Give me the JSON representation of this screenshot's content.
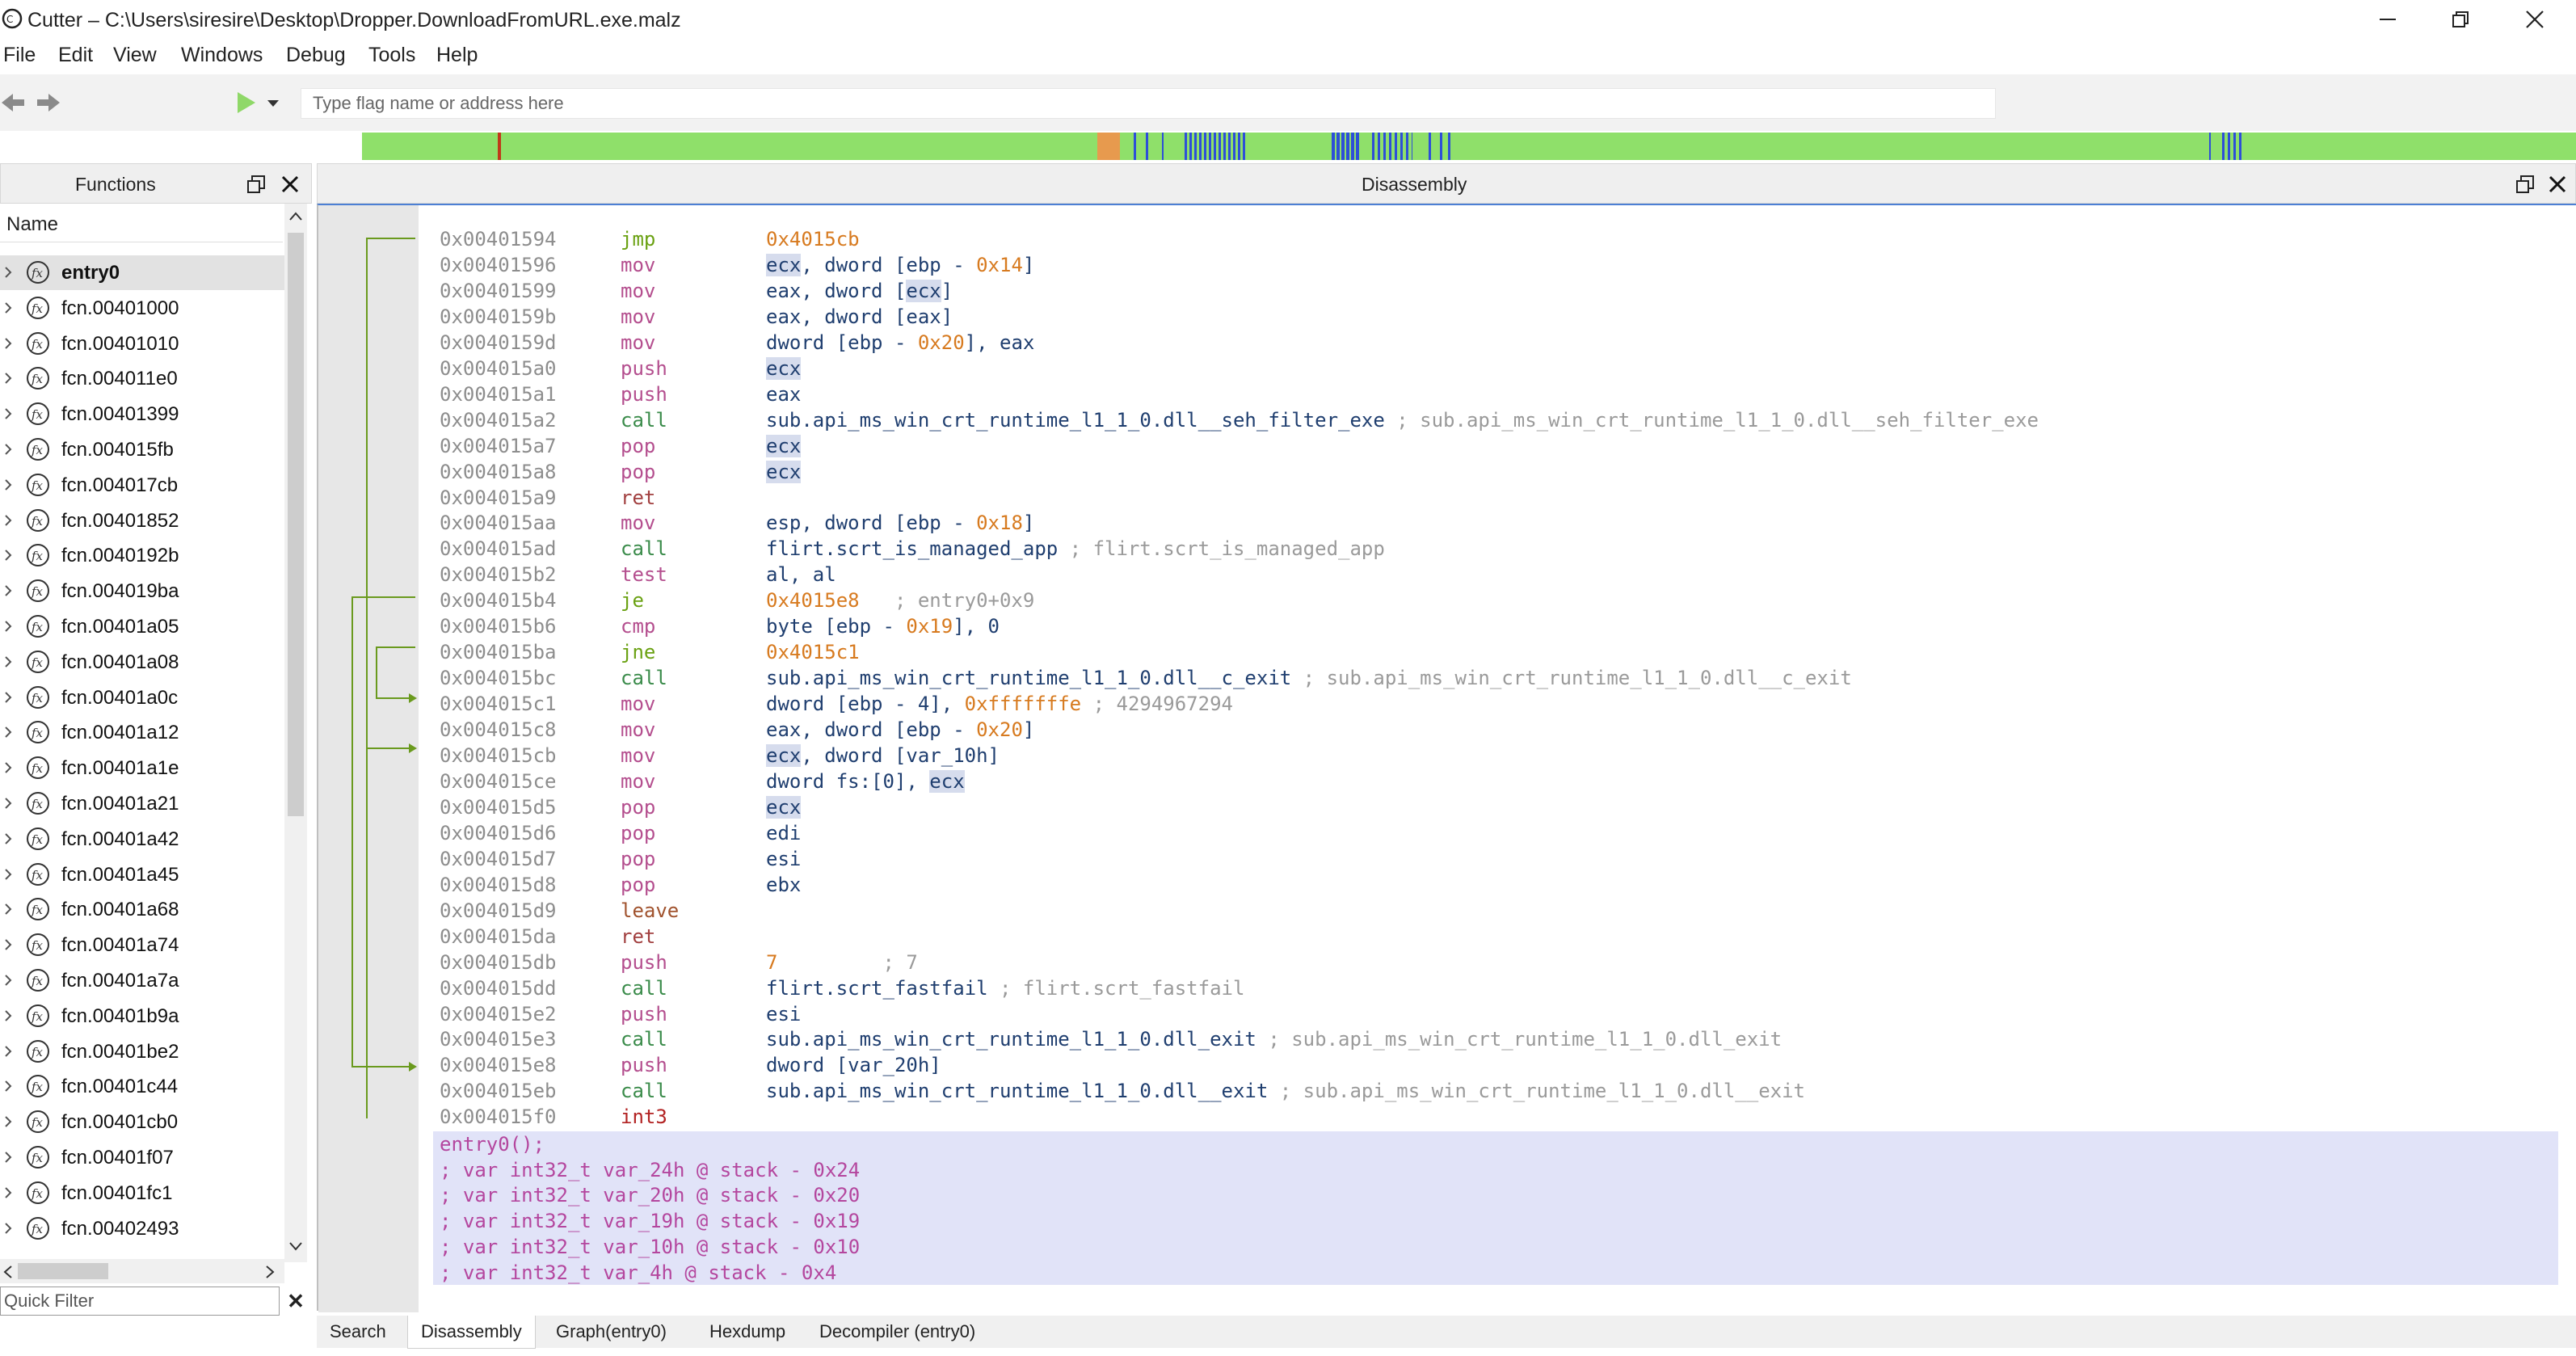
{
  "window": {
    "title": "Cutter – C:\\Users\\siresire\\Desktop\\Dropper.DownloadFromURL.exe.malz",
    "minimize_icon": "minimize-icon",
    "restore_icon": "restore-icon",
    "close_icon": "close-icon"
  },
  "menu": [
    "File",
    "Edit",
    "View",
    "Windows",
    "Debug",
    "Tools",
    "Help"
  ],
  "toolbar": {
    "search_placeholder": "Type flag name or address here"
  },
  "functions_panel": {
    "title": "Functions",
    "column": "Name",
    "filter_placeholder": "Quick Filter",
    "items": [
      "entry0",
      "fcn.00401000",
      "fcn.00401010",
      "fcn.004011e0",
      "fcn.00401399",
      "fcn.004015fb",
      "fcn.004017cb",
      "fcn.00401852",
      "fcn.0040192b",
      "fcn.004019ba",
      "fcn.00401a05",
      "fcn.00401a08",
      "fcn.00401a0c",
      "fcn.00401a12",
      "fcn.00401a1e",
      "fcn.00401a21",
      "fcn.00401a42",
      "fcn.00401a45",
      "fcn.00401a68",
      "fcn.00401a74",
      "fcn.00401a7a",
      "fcn.00401b9a",
      "fcn.00401be2",
      "fcn.00401c44",
      "fcn.00401cb0",
      "fcn.00401f07",
      "fcn.00401fc1",
      "fcn.00402493"
    ]
  },
  "disassembly": {
    "title": "Disassembly",
    "rows": [
      {
        "addr": "0x00401594",
        "mn": "jmp",
        "op": [
          {
            "t": "0x4015cb",
            "c": "o-addr"
          }
        ]
      },
      {
        "addr": "0x00401596",
        "mn": "mov",
        "op": [
          {
            "t": "ecx",
            "c": "o-def reg-hl"
          },
          {
            "t": ", dword [ebp - ",
            "c": "o-def"
          },
          {
            "t": "0x14",
            "c": "o-imm"
          },
          {
            "t": "]",
            "c": "o-def"
          }
        ]
      },
      {
        "addr": "0x00401599",
        "mn": "mov",
        "op": [
          {
            "t": "eax, dword [",
            "c": "o-def"
          },
          {
            "t": "ecx",
            "c": "o-def reg-hl"
          },
          {
            "t": "]",
            "c": "o-def"
          }
        ]
      },
      {
        "addr": "0x0040159b",
        "mn": "mov",
        "op": [
          {
            "t": "eax, dword [eax]",
            "c": "o-def"
          }
        ]
      },
      {
        "addr": "0x0040159d",
        "mn": "mov",
        "op": [
          {
            "t": "dword [ebp - ",
            "c": "o-def"
          },
          {
            "t": "0x20",
            "c": "o-imm"
          },
          {
            "t": "], eax",
            "c": "o-def"
          }
        ]
      },
      {
        "addr": "0x004015a0",
        "mn": "push",
        "op": [
          {
            "t": "ecx",
            "c": "o-def reg-hl"
          }
        ]
      },
      {
        "addr": "0x004015a1",
        "mn": "push",
        "op": [
          {
            "t": "eax",
            "c": "o-def"
          }
        ]
      },
      {
        "addr": "0x004015a2",
        "mn": "call",
        "op": [
          {
            "t": "sub.api_ms_win_crt_runtime_l1_1_0.dll__seh_filter_exe",
            "c": "o-def"
          },
          {
            "t": " ; sub.api_ms_win_crt_runtime_l1_1_0.dll__seh_filter_exe",
            "c": "o-cmt"
          }
        ]
      },
      {
        "addr": "0x004015a7",
        "mn": "pop",
        "op": [
          {
            "t": "ecx",
            "c": "o-def reg-hl"
          }
        ]
      },
      {
        "addr": "0x004015a8",
        "mn": "pop",
        "op": [
          {
            "t": "ecx",
            "c": "o-def reg-hl"
          }
        ]
      },
      {
        "addr": "0x004015a9",
        "mn": "ret",
        "op": []
      },
      {
        "addr": "0x004015aa",
        "mn": "mov",
        "op": [
          {
            "t": "esp, dword [ebp - ",
            "c": "o-def"
          },
          {
            "t": "0x18",
            "c": "o-imm"
          },
          {
            "t": "]",
            "c": "o-def"
          }
        ]
      },
      {
        "addr": "0x004015ad",
        "mn": "call",
        "op": [
          {
            "t": "flirt.scrt_is_managed_app",
            "c": "o-def"
          },
          {
            "t": " ; flirt.scrt_is_managed_app",
            "c": "o-cmt"
          }
        ]
      },
      {
        "addr": "0x004015b2",
        "mn": "test",
        "op": [
          {
            "t": "al, al",
            "c": "o-def"
          }
        ]
      },
      {
        "addr": "0x004015b4",
        "mn": "je",
        "op": [
          {
            "t": "0x4015e8",
            "c": "o-addr"
          },
          {
            "t": "   ; entry0+0x9",
            "c": "o-cmt"
          }
        ]
      },
      {
        "addr": "0x004015b6",
        "mn": "cmp",
        "op": [
          {
            "t": "byte [ebp - ",
            "c": "o-def"
          },
          {
            "t": "0x19",
            "c": "o-imm"
          },
          {
            "t": "], 0",
            "c": "o-def"
          }
        ]
      },
      {
        "addr": "0x004015ba",
        "mn": "jne",
        "op": [
          {
            "t": "0x4015c1",
            "c": "o-addr"
          }
        ]
      },
      {
        "addr": "0x004015bc",
        "mn": "call",
        "op": [
          {
            "t": "sub.api_ms_win_crt_runtime_l1_1_0.dll__c_exit",
            "c": "o-def"
          },
          {
            "t": " ; sub.api_ms_win_crt_runtime_l1_1_0.dll__c_exit",
            "c": "o-cmt"
          }
        ]
      },
      {
        "addr": "0x004015c1",
        "mn": "mov",
        "op": [
          {
            "t": "dword [ebp - 4], ",
            "c": "o-def"
          },
          {
            "t": "0xfffffffe",
            "c": "o-imm"
          },
          {
            "t": " ; 4294967294",
            "c": "o-cmt"
          }
        ]
      },
      {
        "addr": "0x004015c8",
        "mn": "mov",
        "op": [
          {
            "t": "eax, dword [ebp - ",
            "c": "o-def"
          },
          {
            "t": "0x20",
            "c": "o-imm"
          },
          {
            "t": "]",
            "c": "o-def"
          }
        ]
      },
      {
        "addr": "0x004015cb",
        "mn": "mov",
        "op": [
          {
            "t": "ecx",
            "c": "o-def reg-hl"
          },
          {
            "t": ", dword [var_10h]",
            "c": "o-def"
          }
        ]
      },
      {
        "addr": "0x004015ce",
        "mn": "mov",
        "op": [
          {
            "t": "dword fs:[0], ",
            "c": "o-def"
          },
          {
            "t": "ecx",
            "c": "o-def reg-hl"
          }
        ]
      },
      {
        "addr": "0x004015d5",
        "mn": "pop",
        "op": [
          {
            "t": "ecx",
            "c": "o-def reg-hl"
          }
        ]
      },
      {
        "addr": "0x004015d6",
        "mn": "pop",
        "op": [
          {
            "t": "edi",
            "c": "o-def"
          }
        ]
      },
      {
        "addr": "0x004015d7",
        "mn": "pop",
        "op": [
          {
            "t": "esi",
            "c": "o-def"
          }
        ]
      },
      {
        "addr": "0x004015d8",
        "mn": "pop",
        "op": [
          {
            "t": "ebx",
            "c": "o-def"
          }
        ]
      },
      {
        "addr": "0x004015d9",
        "mn": "leave",
        "op": []
      },
      {
        "addr": "0x004015da",
        "mn": "ret",
        "op": []
      },
      {
        "addr": "0x004015db",
        "mn": "push",
        "op": [
          {
            "t": "7",
            "c": "o-imm"
          },
          {
            "t": "         ; 7",
            "c": "o-cmt"
          }
        ]
      },
      {
        "addr": "0x004015dd",
        "mn": "call",
        "op": [
          {
            "t": "flirt.scrt_fastfail",
            "c": "o-def"
          },
          {
            "t": " ; flirt.scrt_fastfail",
            "c": "o-cmt"
          }
        ]
      },
      {
        "addr": "0x004015e2",
        "mn": "push",
        "op": [
          {
            "t": "esi",
            "c": "o-def"
          }
        ]
      },
      {
        "addr": "0x004015e3",
        "mn": "call",
        "op": [
          {
            "t": "sub.api_ms_win_crt_runtime_l1_1_0.dll_exit",
            "c": "o-def"
          },
          {
            "t": " ; sub.api_ms_win_crt_runtime_l1_1_0.dll_exit",
            "c": "o-cmt"
          }
        ]
      },
      {
        "addr": "0x004015e8",
        "mn": "push",
        "op": [
          {
            "t": "dword [var_20h]",
            "c": "o-def"
          }
        ]
      },
      {
        "addr": "0x004015eb",
        "mn": "call",
        "op": [
          {
            "t": "sub.api_ms_win_crt_runtime_l1_1_0.dll__exit",
            "c": "o-def"
          },
          {
            "t": " ; sub.api_ms_win_crt_runtime_l1_1_0.dll__exit",
            "c": "o-cmt"
          }
        ]
      },
      {
        "addr": "0x004015f0",
        "mn": "int3",
        "op": []
      }
    ],
    "function_header": [
      "entry0();",
      "; var int32_t var_24h @ stack - 0x24",
      "; var int32_t var_20h @ stack - 0x20",
      "; var int32_t var_19h @ stack - 0x19",
      "; var int32_t var_10h @ stack - 0x10",
      "; var int32_t var_4h @ stack - 0x4"
    ]
  },
  "bottom_tabs": [
    "Search",
    "Disassembly",
    "Graph(entry0)",
    "Hexdump",
    "Decompiler (entry0)"
  ],
  "active_tab": "Disassembly",
  "colors": {
    "overview_green": "#8fe06a",
    "overview_blue": "#2d4fd8",
    "overview_orange": "#e79a4e",
    "jump_line": "#6a9a1e"
  }
}
